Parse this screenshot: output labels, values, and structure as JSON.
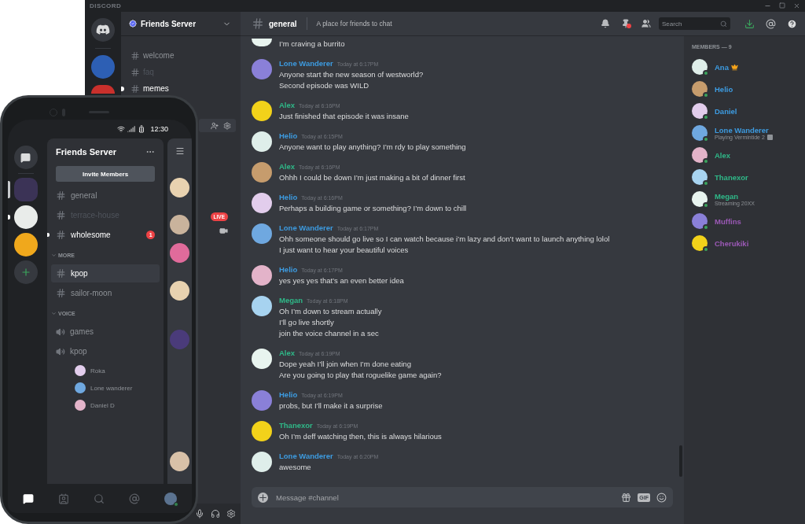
{
  "desktop": {
    "brand": "DISCORD",
    "server_name": "Friends Server",
    "verified": true,
    "channels": [
      {
        "name": "welcome",
        "muted": false,
        "unread": false
      },
      {
        "name": "faq",
        "muted": true,
        "unread": false
      },
      {
        "name": "memes",
        "muted": false,
        "unread": true
      }
    ],
    "live_badge": "LIVE",
    "channel": {
      "name": "general",
      "topic": "A place for friends to chat"
    },
    "search": {
      "placeholder": "Search"
    },
    "messages": [
      {
        "lines": [
          "I’m craving a burrito"
        ]
      },
      {
        "author": "Lone Wanderer",
        "color": "#3d9be0",
        "time": "Today at 6:17PM",
        "lines": [
          "Anyone start the new season of westworld?",
          "Second episode was WILD"
        ]
      },
      {
        "author": "Alex",
        "color": "#2fb888",
        "time": "Today at 6:16PM",
        "lines": [
          "Just finished that episode it was insane"
        ]
      },
      {
        "author": "Helio",
        "color": "#3d9be0",
        "time": "Today at 6:15PM",
        "lines": [
          "Anyone want to play anything? I’m rdy to play something"
        ]
      },
      {
        "author": "Alex",
        "color": "#2fb888",
        "time": "Today at 6:16PM",
        "lines": [
          "Ohhh I could be down I’m just making a bit of dinner first"
        ]
      },
      {
        "author": "Helio",
        "color": "#3d9be0",
        "time": "Today at 6:16PM",
        "lines": [
          "Perhaps a building game or something? I’m down to chill"
        ]
      },
      {
        "author": "Lone Wanderer",
        "color": "#3d9be0",
        "time": "Today at 6:17PM",
        "lines": [
          "Ohh someone should go live so I can watch because i’m lazy and don’t want to launch anything lolol",
          "I just want to hear your beautiful voices"
        ]
      },
      {
        "author": "Helio",
        "color": "#3d9be0",
        "time": "Today at 6:17PM",
        "lines": [
          "yes yes yes that’s an even better idea"
        ]
      },
      {
        "author": "Megan",
        "color": "#2fb888",
        "time": "Today at 6:18PM",
        "lines": [
          "Oh I’m down to stream actually",
          "I’ll go live shortly",
          "join the voice channel in a sec"
        ]
      },
      {
        "author": "Alex",
        "color": "#2fb888",
        "time": "Today at 6:19PM",
        "lines": [
          "Dope yeah I’ll join when I’m done eating",
          "Are you going to play that roguelike game again?"
        ]
      },
      {
        "author": "Helio",
        "color": "#3d9be0",
        "time": "Today at 6:19PM",
        "lines": [
          "probs, but I’ll make it a surprise"
        ]
      },
      {
        "author": "Thanexor",
        "color": "#2fb888",
        "time": "Today at 6:19PM",
        "lines": [
          "Oh I’m deff watching then, this is always hilarious"
        ]
      },
      {
        "author": "Lone Wanderer",
        "color": "#3d9be0",
        "time": "Today at 6:20PM",
        "lines": [
          "awesome"
        ]
      }
    ],
    "composer": {
      "placeholder": "Message #channel",
      "gif": "GIF"
    },
    "members_heading": "MEMBERS — 9",
    "members": [
      {
        "name": "Ana",
        "color": "#3d9be0",
        "owner": true
      },
      {
        "name": "Helio",
        "color": "#3d9be0",
        "owner": false
      },
      {
        "name": "Daniel",
        "color": "#3d9be0",
        "owner": false
      },
      {
        "name": "Lone Wanderer",
        "color": "#3d9be0",
        "owner": false,
        "activity": "Playing Vermintide 2"
      },
      {
        "name": "Alex",
        "color": "#2fb888",
        "owner": false
      },
      {
        "name": "Thanexor",
        "color": "#2fb888",
        "owner": false
      },
      {
        "name": "Megan",
        "color": "#2fb888",
        "owner": false,
        "activity": "Streaming 20XX"
      },
      {
        "name": "Muffins",
        "color": "#9b59b6",
        "owner": false
      },
      {
        "name": "Cherukiki",
        "color": "#9b59b6",
        "owner": false
      }
    ]
  },
  "phone": {
    "time": "12:30",
    "server_name": "Friends Server",
    "invite_button": "Invite Members",
    "servers": [
      {
        "selected": true,
        "unread": false
      },
      {
        "selected": false,
        "unread": true
      },
      {
        "selected": false,
        "unread": false
      }
    ],
    "channels": [
      {
        "name": "general",
        "selected": false,
        "muted": false,
        "unread": false
      },
      {
        "name": "terrace-house",
        "selected": false,
        "muted": true,
        "unread": false
      },
      {
        "name": "wholesome",
        "selected": false,
        "muted": false,
        "unread": true,
        "badge": "1"
      }
    ],
    "categories": [
      {
        "name": "MORE",
        "expanded": true,
        "channels": [
          {
            "kind": "text",
            "name": "kpop",
            "selected": true
          },
          {
            "kind": "text",
            "name": "sailor-moon",
            "selected": false
          }
        ]
      },
      {
        "name": "VOICE",
        "expanded": true,
        "channels": [
          {
            "kind": "voice",
            "name": "games",
            "selected": false
          },
          {
            "kind": "voice",
            "name": "kpop",
            "selected": false,
            "children": [
              {
                "name": "Roka"
              },
              {
                "name": "Lone wanderer"
              },
              {
                "name": "Daniel D"
              }
            ]
          }
        ]
      }
    ],
    "nav": [
      {
        "kind": "home",
        "selected": true
      },
      {
        "kind": "friends",
        "selected": false
      },
      {
        "kind": "search",
        "selected": false
      },
      {
        "kind": "mentions",
        "selected": false
      },
      {
        "kind": "profile",
        "selected": false
      }
    ]
  }
}
